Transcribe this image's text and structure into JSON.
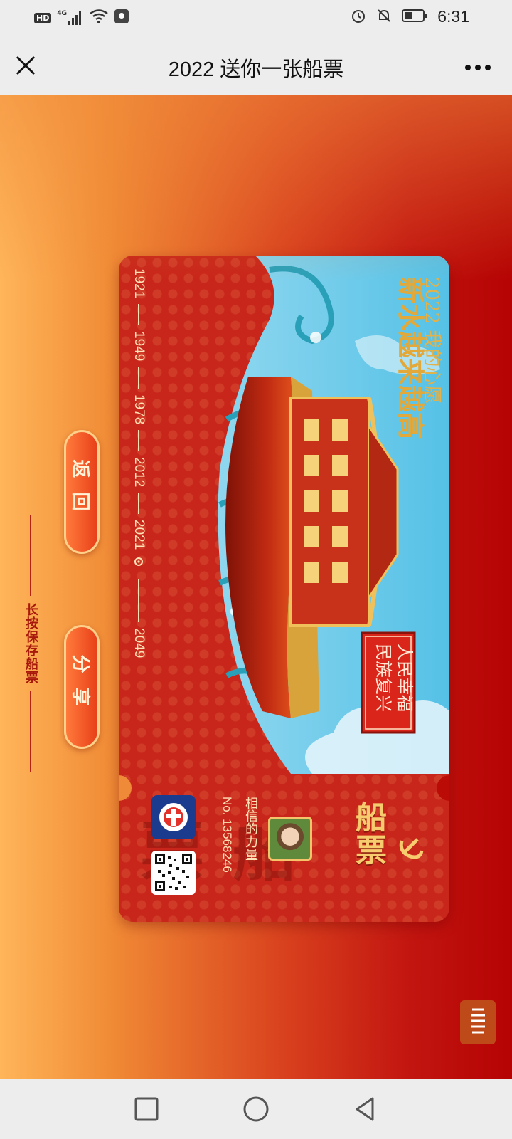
{
  "status_bar": {
    "hd_label": "HD",
    "network_label": "4G",
    "time": "6:31",
    "icons": [
      "signal-icon",
      "wifi-icon",
      "huawei-app-icon",
      "alarm-icon",
      "mute-icon",
      "battery-icon"
    ]
  },
  "title_bar": {
    "title": "2022 送你一张船票"
  },
  "page": {
    "back_label": "返回",
    "share_label": "分享",
    "save_hint": "长按保存船票",
    "accent": "#e8401a",
    "gradient_colors": [
      "#ffb55a",
      "#b50303"
    ]
  },
  "ticket": {
    "timeline_years": [
      "1921",
      "1949",
      "1978",
      "2012",
      "2021",
      "2049"
    ],
    "headline_line1": "2022 我的心愿",
    "headline_line2": "新水越来越高",
    "seal_line1": "人民幸福",
    "seal_line2": "民族复兴",
    "quote": "相信的力量",
    "ticket_no": "No. 13568246",
    "brand": "船票",
    "brand_shadow": "船票"
  }
}
